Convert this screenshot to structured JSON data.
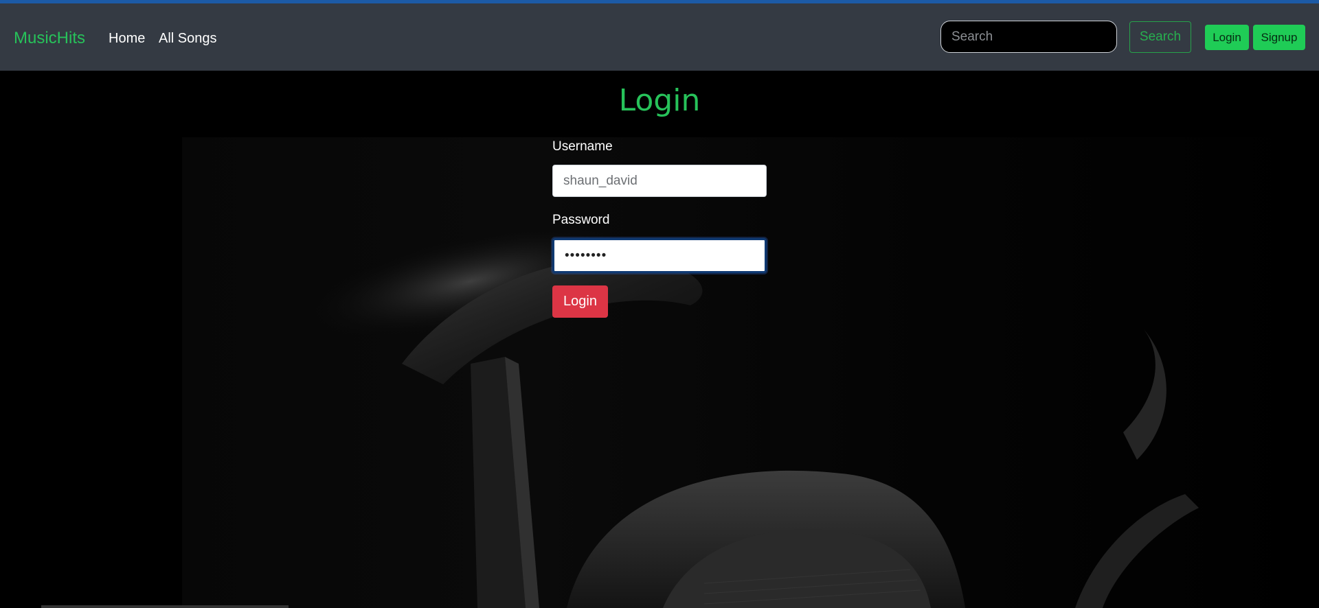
{
  "navbar": {
    "brand": "MusicHits",
    "links": [
      "Home",
      "All Songs"
    ],
    "search_placeholder": "Search",
    "search_button": "Search",
    "login_button": "Login",
    "signup_button": "Signup"
  },
  "form": {
    "title": "Login",
    "username_label": "Username",
    "username_value": "shaun_david",
    "password_label": "Password",
    "password_value": "shaunpwd",
    "submit_label": "Login"
  },
  "colors": {
    "accent_green": "#27c25a",
    "navbar_bg": "#343a43",
    "danger": "#dc3545",
    "top_line": "#1c5aa6"
  }
}
